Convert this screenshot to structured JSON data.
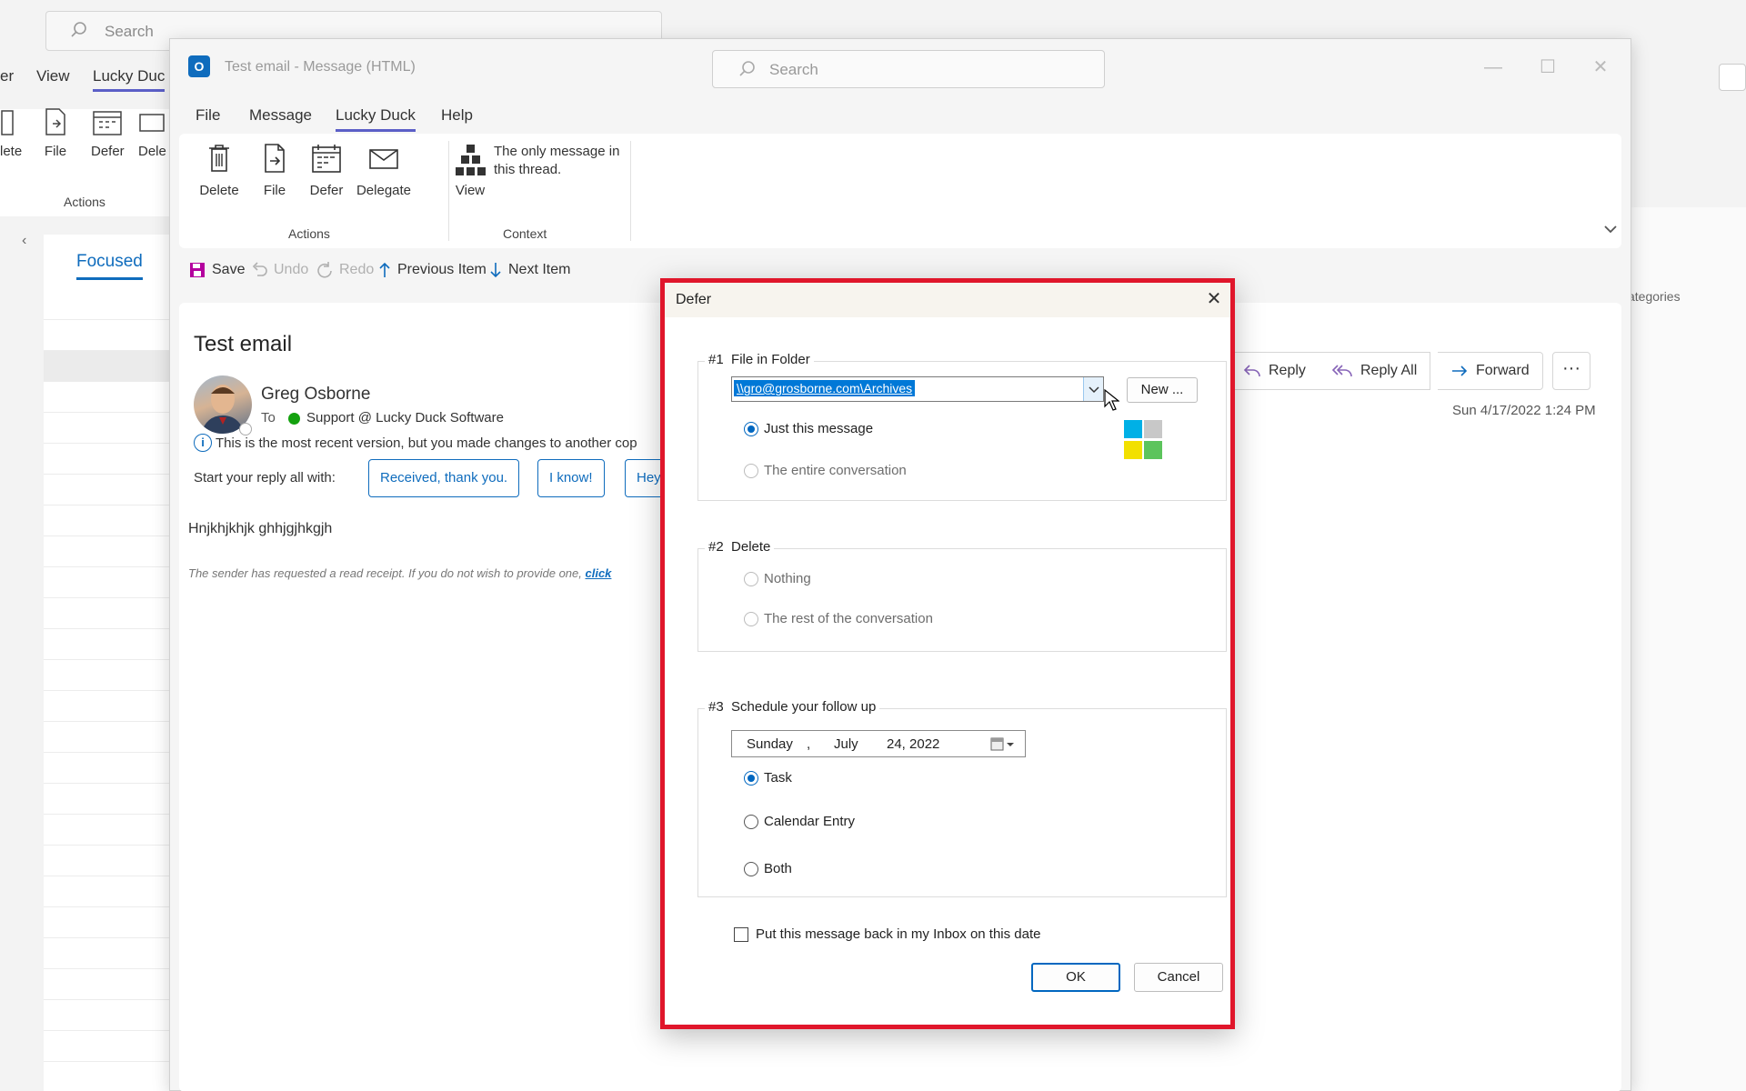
{
  "background": {
    "search_placeholder": "Search",
    "tabs": [
      "er",
      "View",
      "Lucky Duc"
    ],
    "buttons": [
      "lete",
      "File",
      "Defer",
      "Dele"
    ],
    "actions_label": "Actions",
    "focused_tab": "Focused",
    "categories_col": "ategories"
  },
  "window": {
    "title": "Test email  -  Message (HTML)",
    "search_placeholder": "Search",
    "controls": {
      "minimize": "—",
      "maximize": "☐",
      "close": "✕"
    }
  },
  "menu": {
    "tabs": [
      "File",
      "Message",
      "Lucky Duck",
      "Help"
    ],
    "active_tab": "Lucky Duck"
  },
  "ribbon": {
    "actions": [
      {
        "label": "Delete",
        "icon": "trash-icon"
      },
      {
        "label": "File",
        "icon": "file-icon"
      },
      {
        "label": "Defer",
        "icon": "calendar-icon"
      },
      {
        "label": "Delegate",
        "icon": "envelope-icon"
      }
    ],
    "actions_group": "Actions",
    "view_label": "View",
    "context_text": "The only message in this thread.",
    "context_group": "Context"
  },
  "qat": {
    "save": "Save",
    "undo": "Undo",
    "redo": "Redo",
    "previous": "Previous Item",
    "next": "Next Item"
  },
  "message": {
    "subject": "Test email",
    "sender": "Greg Osborne",
    "to_label": "To",
    "to_value": "Support @ Lucky Duck Software",
    "info_text": "This is the most recent version, but you made changes to another cop",
    "reply_prompt": "Start your reply all with:",
    "quick_replies": [
      "Received, thank you.",
      "I know!",
      "Hey"
    ],
    "body": "Hnjkhjkhjk ghhjgjhkgjh",
    "receipt_text": "The sender has requested a read receipt. If you do not wish to provide one, ",
    "receipt_link": "click",
    "actions": {
      "reply": "Reply",
      "reply_all": "Reply All",
      "forward": "Forward",
      "more": "···"
    },
    "date": "Sun 4/17/2022 1:24 PM"
  },
  "defer": {
    "title": "Defer",
    "close": "✕",
    "group1_num": "#1",
    "group1": "File in Folder",
    "folder_value": "\\\\gro@grosborne.com\\Archives",
    "new_button": "New ...",
    "opt_just_message": "Just this message",
    "opt_entire_conversation": "The entire conversation",
    "group2_num": "#2",
    "group2": "Delete",
    "opt_nothing": "Nothing",
    "opt_rest": "The rest of the conversation",
    "group3_num": "#3",
    "group3": "Schedule your follow up",
    "date": {
      "weekday": "Sunday",
      "comma": ",",
      "month": "July",
      "daymonthyear": "24, 2022"
    },
    "opt_task": "Task",
    "opt_calendar": "Calendar Entry",
    "opt_both": "Both",
    "inbox_check": "Put this message back in my Inbox on this date",
    "ok": "OK",
    "cancel": "Cancel",
    "colors": [
      "#00b0e6",
      "#c8c8c8",
      "#f2e000",
      "#5cc45c"
    ]
  }
}
